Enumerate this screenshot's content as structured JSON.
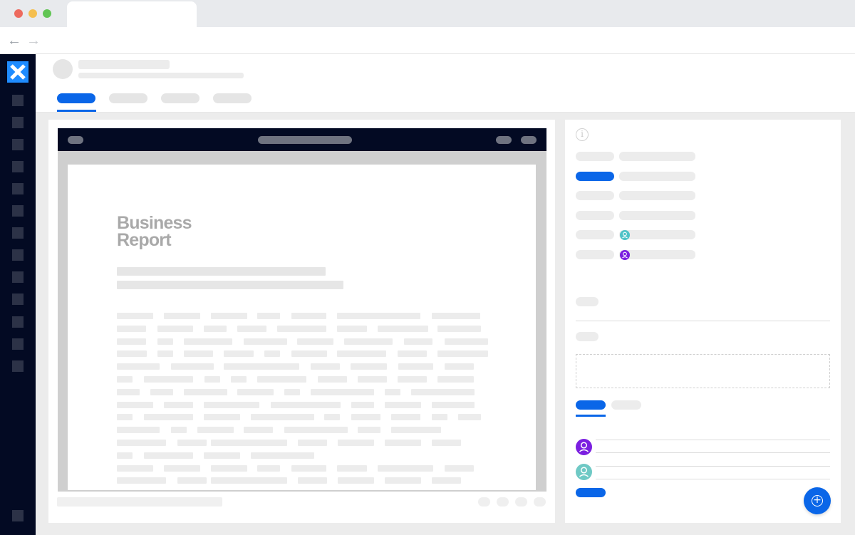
{
  "browser": {
    "traffic_lights": {
      "close": "#ed6a5e",
      "minimize": "#f5bf4f",
      "maximize": "#61c554"
    },
    "back_icon": "arrow-left",
    "forward_icon": "arrow-right",
    "back_glyph": "←",
    "forward_glyph": "→"
  },
  "sidebar": {
    "background": "#030a23",
    "logo_color": "#1f8cff",
    "logo_glyph": "✕",
    "item_count": 13
  },
  "tabs": {
    "active_color": "#0a66e8"
  },
  "document": {
    "title_line1": "Business",
    "title_line2": "Report"
  },
  "details_panel": {
    "info_glyph": "i",
    "assignee_colors": [
      "#4fc3c7",
      "#7b1fe0"
    ]
  },
  "comments": {
    "avatar_colors": [
      "#7b1fe0",
      "#6fc9c5"
    ]
  },
  "fab": {
    "glyph": "+",
    "color": "#0a66e8"
  }
}
